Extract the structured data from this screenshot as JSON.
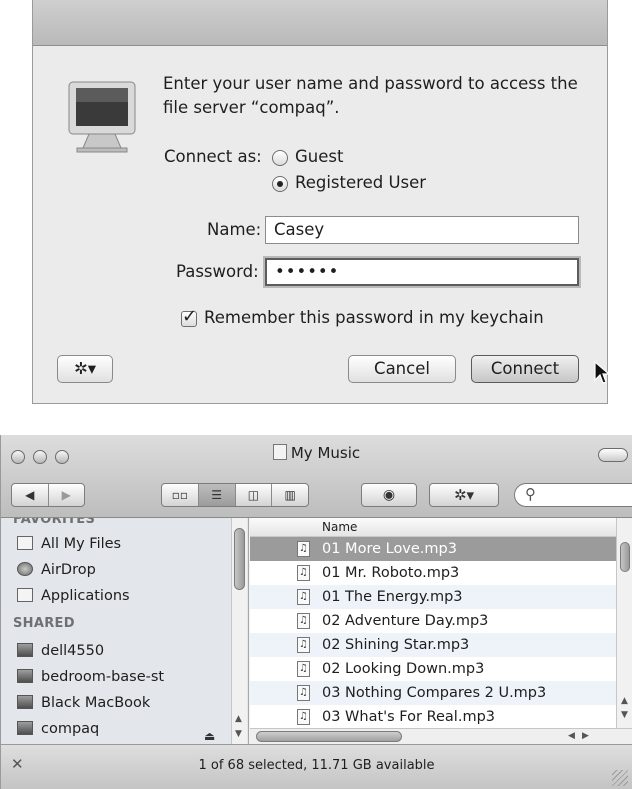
{
  "dialog": {
    "prompt": "Enter your user name and password to access the file server “compaq”.",
    "connect_as_label": "Connect as:",
    "options": [
      {
        "label": "Guest",
        "selected": false
      },
      {
        "label": "Registered User",
        "selected": true
      }
    ],
    "name_label": "Name:",
    "name_value": "Casey",
    "password_label": "Password:",
    "password_value": "••••••",
    "remember_label": "Remember this password in my keychain",
    "remember_checked": true,
    "cancel_label": "Cancel",
    "connect_label": "Connect",
    "action_icon": "gear-icon"
  },
  "finder": {
    "title": "My Music",
    "view_modes": [
      "icon",
      "list",
      "column",
      "cover-flow"
    ],
    "active_view": "list",
    "sidebar": {
      "favorites_head": "FAVORITES",
      "favorites": [
        "All My Files",
        "AirDrop",
        "Applications"
      ],
      "shared_head": "SHARED",
      "shared": [
        "dell4550",
        "bedroom-base-st",
        "Black MacBook",
        "compaq"
      ]
    },
    "column_header": "Name",
    "files": [
      "01 More Love.mp3",
      "01 Mr. Roboto.mp3",
      "01 The Energy.mp3",
      "02 Adventure Day.mp3",
      "02 Shining Star.mp3",
      "02 Looking Down.mp3",
      "03 Nothing Compares 2 U.mp3",
      "03 What's For Real.mp3"
    ],
    "selected_file": "01 More Love.mp3",
    "status": "1 of 68 selected, 11.71 GB available"
  }
}
